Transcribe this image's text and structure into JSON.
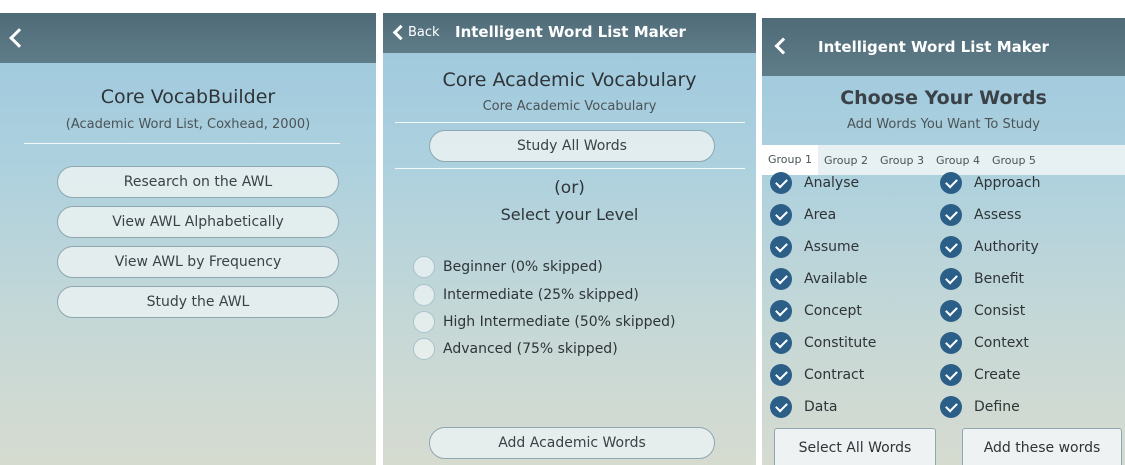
{
  "panel1": {
    "title": "Core VocabBuilder",
    "subtitle": "(Academic Word List, Coxhead, 2000)",
    "buttons": [
      "Research on the AWL",
      "View AWL Alphabetically",
      "View AWL by Frequency",
      "Study the AWL"
    ]
  },
  "panel2": {
    "nav": {
      "back_label": "Back",
      "title": "Intelligent Word List Maker"
    },
    "title": "Core Academic Vocabulary",
    "subtitle": "Core Academic Vocabulary",
    "study_all_label": "Study All Words",
    "or_label": "(or)",
    "level_heading": "Select your Level",
    "levels": [
      "Beginner (0% skipped)",
      "Intermediate (25% skipped)",
      "High Intermediate (50% skipped)",
      "Advanced (75% skipped)"
    ],
    "add_button_label": "Add Academic Words"
  },
  "panel3": {
    "nav": {
      "title": "Intelligent Word List Maker"
    },
    "title": "Choose Your Words",
    "subtitle": "Add Words You Want To Study",
    "tabs": [
      "Group 1",
      "Group 2",
      "Group 3",
      "Group 4",
      "Group 5"
    ],
    "words_left": [
      "Analyse",
      "Area",
      "Assume",
      "Available",
      "Concept",
      "Constitute",
      "Contract",
      "Data"
    ],
    "words_right": [
      "Approach",
      "Assess",
      "Authority",
      "Benefit",
      "Consist",
      "Context",
      "Create",
      "Define"
    ],
    "select_all_label": "Select All Words",
    "add_words_label": "Add these words"
  },
  "colors": {
    "navbar": "#5a7582",
    "check": "#2c5f88",
    "pill_border": "#8ea7b1"
  }
}
